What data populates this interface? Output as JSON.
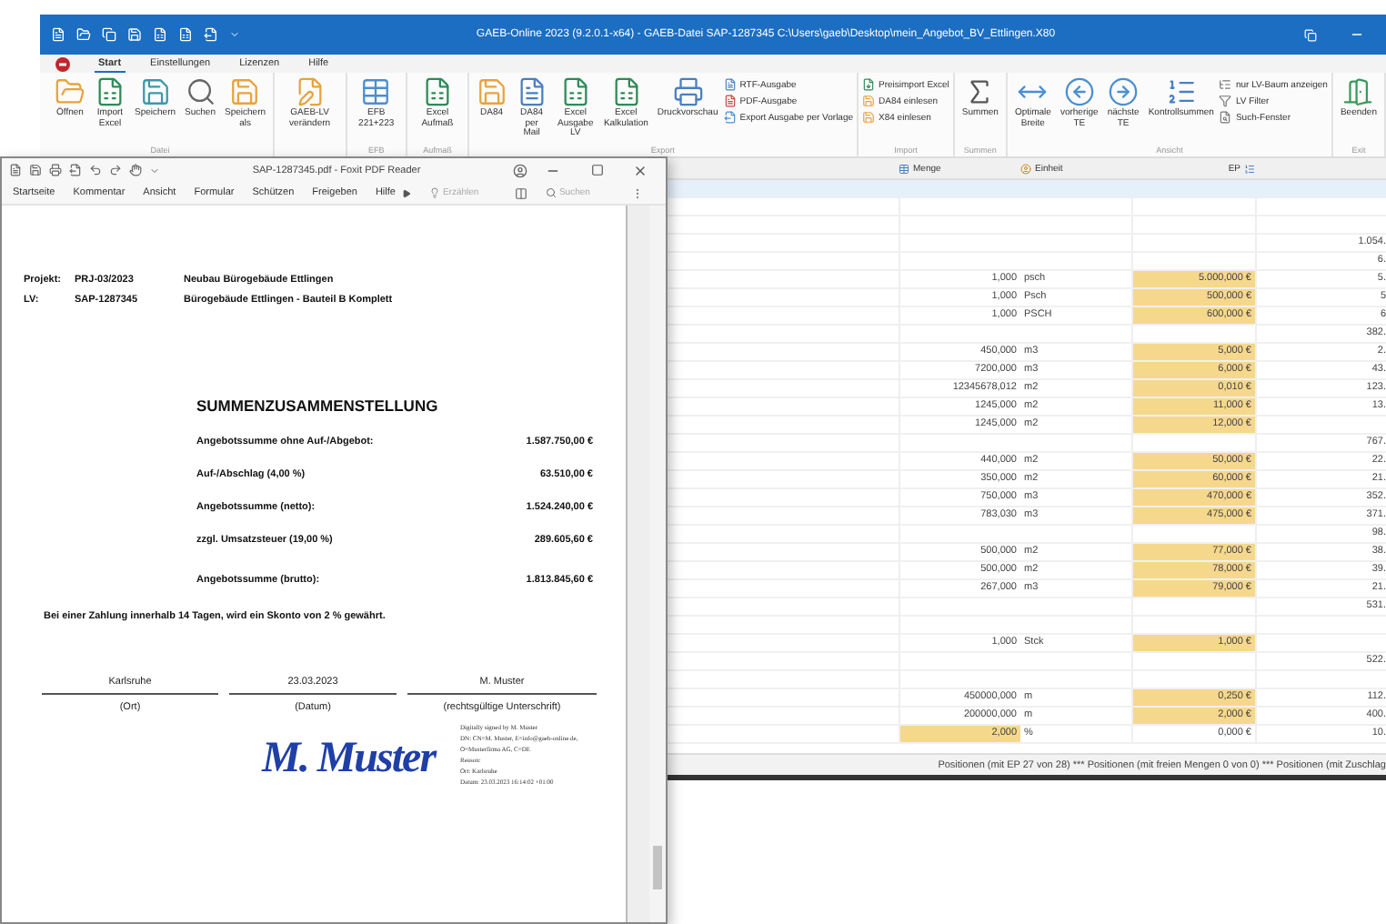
{
  "gaeb_window": {
    "title": "GAEB-Online 2023 (9.2.0.1-x64) - GAEB-Datei SAP-1287345 C:\\Users\\gaeb\\Desktop\\mein_Angebot_BV_Ettlingen.X80",
    "tabs": [
      {
        "label": "Start",
        "selected": true
      },
      {
        "label": "Einstellungen",
        "selected": false
      },
      {
        "label": "Lizenzen",
        "selected": false
      },
      {
        "label": "Hilfe",
        "selected": false
      }
    ],
    "ribbon_groups": [
      {
        "label": "Datei",
        "buttons": [
          {
            "label": "Öffnen",
            "kind": "large"
          },
          {
            "label": "Import Excel",
            "kind": "large"
          },
          {
            "label": "Speichern",
            "kind": "large"
          },
          {
            "label": "Suchen",
            "kind": "large"
          },
          {
            "label": "Speichern als",
            "kind": "large"
          }
        ]
      },
      {
        "buttons": [
          {
            "label": "GAEB-LV verändern",
            "kind": "large"
          }
        ]
      },
      {
        "label": "EFB",
        "buttons": [
          {
            "label": "EFB 221+223",
            "kind": "large"
          }
        ]
      },
      {
        "label": "Aufmaß",
        "buttons": [
          {
            "label": "Excel Aufmaß",
            "kind": "large"
          }
        ]
      },
      {
        "label": "Export",
        "buttons": [
          {
            "label": "DA84",
            "kind": "large"
          },
          {
            "label": "DA84 per Mail",
            "kind": "large"
          },
          {
            "label": "Excel Ausgabe LV",
            "kind": "large"
          },
          {
            "label": "Excel Kalkulation",
            "kind": "large"
          },
          {
            "label": "Druckvorschau",
            "kind": "large"
          },
          {
            "label": "RTF-Ausgabe",
            "kind": "small"
          },
          {
            "label": "PDF-Ausgabe",
            "kind": "small"
          },
          {
            "label": "Export Ausgabe per Vorlage",
            "kind": "small"
          }
        ]
      },
      {
        "label": "Import",
        "buttons": [
          {
            "label": "Preisimport Excel",
            "kind": "small"
          },
          {
            "label": "DA84 einlesen",
            "kind": "small"
          },
          {
            "label": "X84 einlesen",
            "kind": "small"
          }
        ]
      },
      {
        "label": "Summen",
        "buttons": [
          {
            "label": "Summen",
            "kind": "large"
          }
        ]
      },
      {
        "label": "Ansicht",
        "buttons": [
          {
            "label": "Optimale Breite",
            "kind": "large"
          },
          {
            "label": "vorherige TE",
            "kind": "large"
          },
          {
            "label": "nächste TE",
            "kind": "large"
          },
          {
            "label": "Kontrollsummen",
            "kind": "large"
          },
          {
            "label": "nur LV-Baum anzeigen",
            "kind": "small"
          },
          {
            "label": "LV Filter",
            "kind": "small"
          },
          {
            "label": "Such-Fenster",
            "kind": "small"
          }
        ]
      },
      {
        "label": "Exit",
        "buttons": [
          {
            "label": "Beenden",
            "kind": "large"
          }
        ]
      }
    ],
    "table": {
      "columns": [
        "Menge",
        "Einheit",
        "EP"
      ],
      "rows": [
        {
          "menge_marked": false,
          "ep_marked": false
        },
        {
          "menge_marked": false,
          "ep_marked": false
        },
        {
          "total": "1.054.",
          "menge_marked": false,
          "ep_marked": false
        },
        {
          "total": "6.",
          "menge_marked": false,
          "ep_marked": false
        },
        {
          "menge": "1,000",
          "einheit": "psch",
          "ep": "5.000,000 €",
          "total": "5.",
          "menge_marked": false,
          "ep_marked": true
        },
        {
          "menge": "1,000",
          "einheit": "Psch",
          "ep": "500,000 €",
          "total": "5",
          "menge_marked": false,
          "ep_marked": true
        },
        {
          "menge": "1,000",
          "einheit": "PSCH",
          "ep": "600,000 €",
          "total": "6",
          "menge_marked": false,
          "ep_marked": true
        },
        {
          "total": "382.",
          "menge_marked": false,
          "ep_marked": false
        },
        {
          "menge": "450,000",
          "einheit": "m3",
          "ep": "5,000 €",
          "total": "2.",
          "menge_marked": false,
          "ep_marked": true
        },
        {
          "menge": "7200,000",
          "einheit": "m3",
          "ep": "6,000 €",
          "total": "43.",
          "menge_marked": false,
          "ep_marked": true
        },
        {
          "menge": "12345678,012",
          "einheit": "m2",
          "ep": "0,010 €",
          "total": "123.",
          "menge_marked": false,
          "ep_marked": true
        },
        {
          "menge": "1245,000",
          "einheit": "m2",
          "ep": "11,000 €",
          "total": "13.",
          "menge_marked": false,
          "ep_marked": true
        },
        {
          "menge": "1245,000",
          "einheit": "m2",
          "ep": "12,000 €",
          "menge_marked": false,
          "ep_marked": true
        },
        {
          "total": "767.",
          "menge_marked": false,
          "ep_marked": false
        },
        {
          "menge": "440,000",
          "einheit": "m2",
          "ep": "50,000 €",
          "total": "22.",
          "menge_marked": false,
          "ep_marked": true
        },
        {
          "menge": "350,000",
          "einheit": "m2",
          "ep": "60,000 €",
          "total": "21.",
          "menge_marked": false,
          "ep_marked": true
        },
        {
          "menge": "750,000",
          "einheit": "m3",
          "ep": "470,000 €",
          "total": "352.",
          "menge_marked": false,
          "ep_marked": true
        },
        {
          "menge": "783,030",
          "einheit": "m3",
          "ep": "475,000 €",
          "total": "371.",
          "menge_marked": false,
          "ep_marked": true
        },
        {
          "total": "98.",
          "menge_marked": false,
          "ep_marked": false
        },
        {
          "menge": "500,000",
          "einheit": "m2",
          "ep": "77,000 €",
          "total": "38.",
          "menge_marked": false,
          "ep_marked": true
        },
        {
          "menge": "500,000",
          "einheit": "m2",
          "ep": "78,000 €",
          "total": "39.",
          "menge_marked": false,
          "ep_marked": true
        },
        {
          "menge": "267,000",
          "einheit": "m3",
          "ep": "79,000 €",
          "total": "21.",
          "menge_marked": false,
          "ep_marked": true
        },
        {
          "total": "531.",
          "menge_marked": false,
          "ep_marked": false
        },
        {
          "menge_marked": false,
          "ep_marked": false
        },
        {
          "menge": "1,000",
          "einheit": "Stck",
          "ep": "1,000 €",
          "menge_marked": false,
          "ep_marked": true
        },
        {
          "total": "522.",
          "menge_marked": false,
          "ep_marked": false
        },
        {
          "menge_marked": false,
          "ep_marked": false
        },
        {
          "menge": "450000,000",
          "einheit": "m",
          "ep": "0,250 €",
          "total": "112.",
          "menge_marked": false,
          "ep_marked": true
        },
        {
          "menge": "200000,000",
          "einheit": "m",
          "ep": "2,000 €",
          "total": "400.",
          "menge_marked": false,
          "ep_marked": true
        },
        {
          "menge": "2,000",
          "einheit": "%",
          "ep": "0,000 €",
          "total": "10.",
          "menge_marked": true,
          "ep_marked": false
        }
      ]
    },
    "status_bar": "Positionen (mit EP 27 von 28) *** Positionen (mit freien Mengen 0 von 0) *** Positionen (mit Zuschlag"
  },
  "pdf_window": {
    "title": "SAP-1287345.pdf - Foxit PDF Reader",
    "menu": [
      "Startseite",
      "Kommentar",
      "Ansicht",
      "Formular",
      "Schützen",
      "Freigeben",
      "Hilfe"
    ],
    "tell_me": {
      "placeholder": "Erzählen"
    },
    "search": {
      "placeholder": "Suchen"
    },
    "document": {
      "header": [
        {
          "label": "Projekt:",
          "code": "PRJ-03/2023",
          "name": "Neubau Bürogebäude Ettlingen"
        },
        {
          "label": "LV:",
          "code": "SAP-1287345",
          "name": "Bürogebäude Ettlingen - Bauteil B Komplett"
        }
      ],
      "heading": "SUMMENZUSAMMENSTELLUNG",
      "sums": [
        {
          "label": "Angebotssumme ohne Auf-/Abgebot:",
          "value": "1.587.750,00 €"
        },
        {
          "label": "Auf-/Abschlag (4,00 %)",
          "value": "63.510,00 €"
        },
        {
          "label": "Angebotssumme (netto):",
          "value": "1.524.240,00 €"
        },
        {
          "label": "zzgl. Umsatzsteuer (19,00 %)",
          "value": "289.605,60 €"
        },
        {
          "label": "Angebotssumme (brutto):",
          "value": "1.813.845,60 €"
        }
      ],
      "note": "Bei einer Zahlung innerhalb 14 Tagen, wird ein Skonto von 2 % gewährt.",
      "signature_fields": [
        {
          "value": "Karlsruhe",
          "caption": "(Ort)"
        },
        {
          "value": "23.03.2023",
          "caption": "(Datum)"
        },
        {
          "value": "M. Muster",
          "caption": "(rechtsgültige Unterschrift)"
        }
      ],
      "handwritten_signature": "M. Muster",
      "digital_signature": [
        "Digitally signed by M. Muster",
        "DN: CN=M. Muster, E=info@gaeb-online.de,",
        "O=Musterfirma AG, C=DE",
        "Reason:",
        "Ort: Karlsruhe",
        "Datum: 23.03.2023 16:14:02 +01:00"
      ]
    }
  }
}
